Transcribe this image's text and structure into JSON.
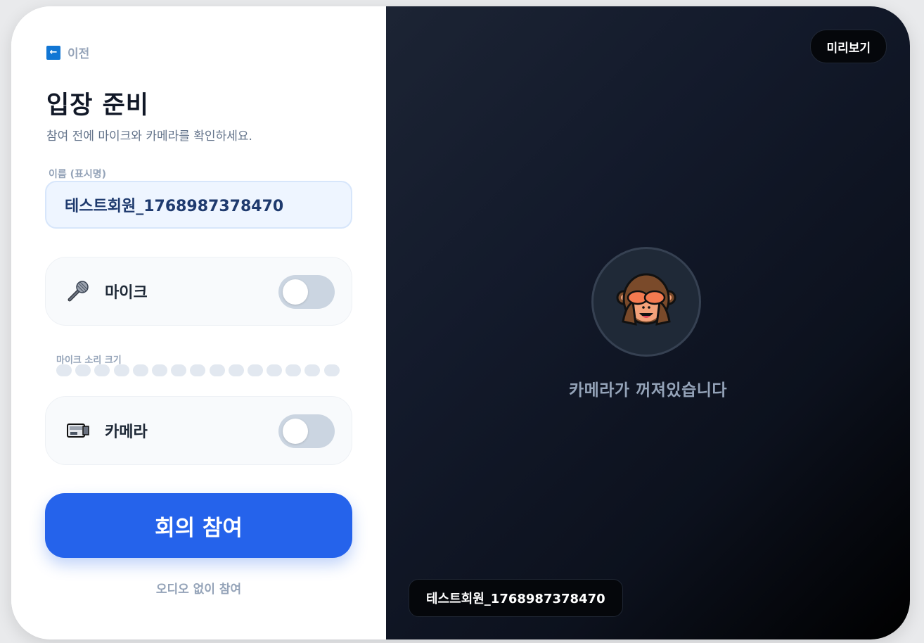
{
  "back": {
    "label": "이전",
    "icon": "left-arrow-icon"
  },
  "header": {
    "title": "입장 준비",
    "subtitle": "참여 전에 마이크와 카메라를 확인하세요."
  },
  "name_field": {
    "label": "이름 (표시명)",
    "value": "테스트회원_1768987378470"
  },
  "mic": {
    "label": "마이크",
    "icon": "microphone-icon",
    "enabled": false
  },
  "mic_level": {
    "label": "마이크 소리 크기",
    "segments": 15,
    "level": 0
  },
  "camera": {
    "label": "카메라",
    "icon": "video-camera-icon",
    "enabled": false
  },
  "join_button": {
    "label": "회의 참여"
  },
  "join_no_audio": {
    "label": "오디오 없이 참여"
  },
  "preview": {
    "badge": "미리보기",
    "avatar_icon": "see-no-evil-monkey-icon",
    "camera_off_text": "카메라가 꺼져있습니다",
    "name_tag": "테스트회원_1768987378470"
  },
  "colors": {
    "accent": "#2563eb",
    "toggle_off": "#cbd5e1",
    "preview_bg": "#0c111d"
  }
}
